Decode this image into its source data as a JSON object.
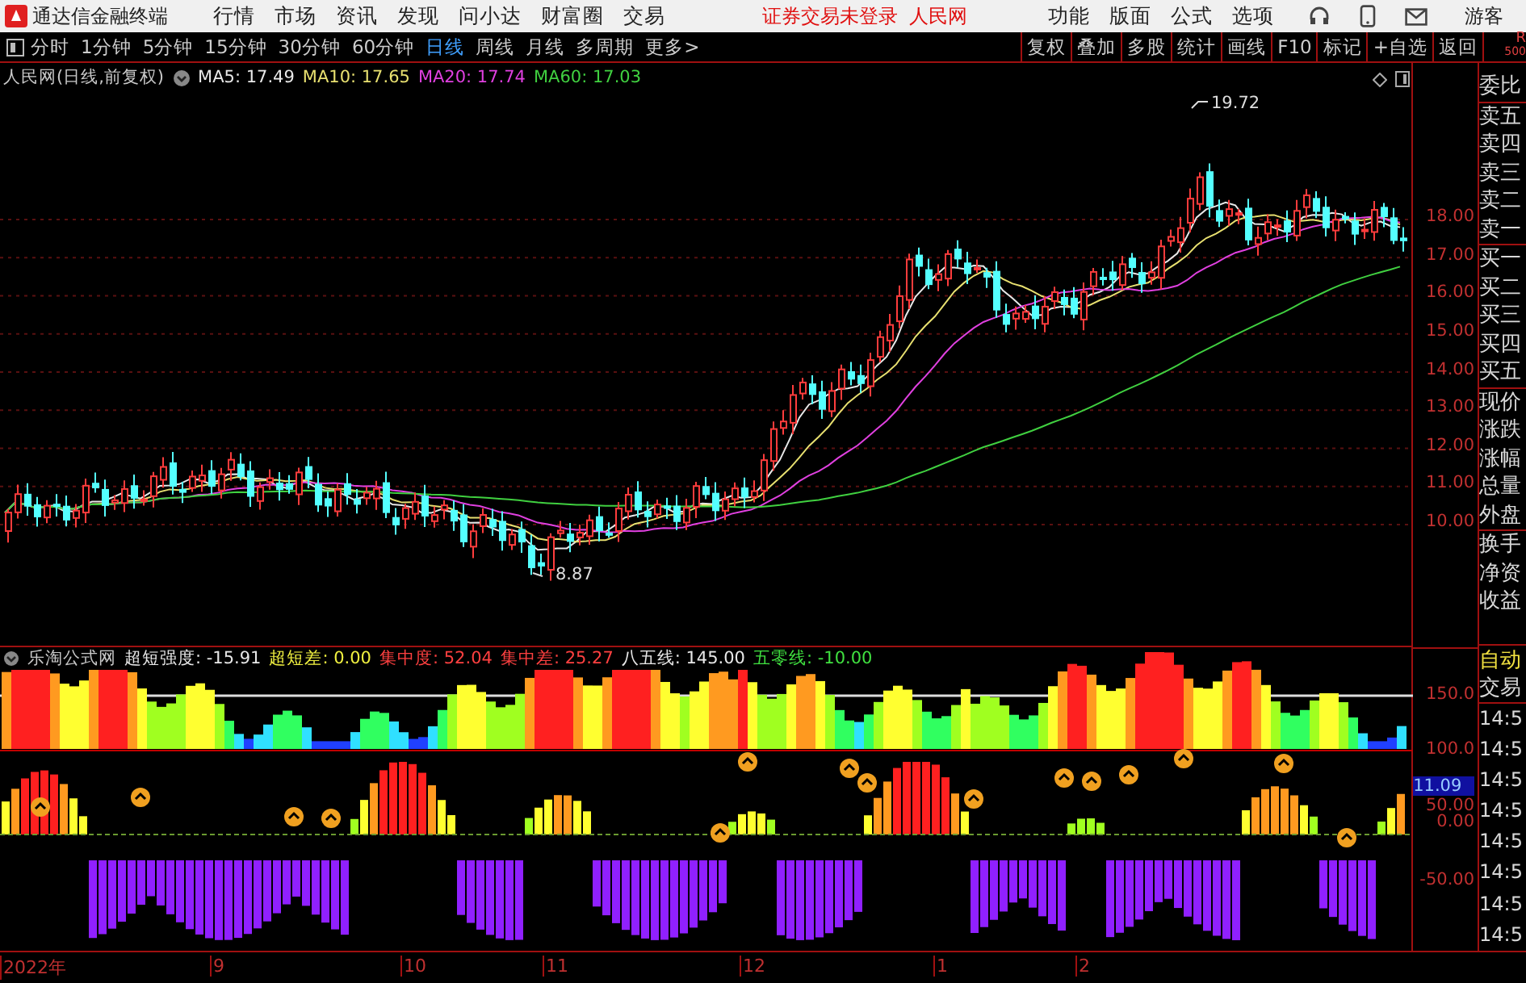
{
  "app": {
    "title": "通达信金融终端",
    "menu": [
      "行情",
      "市场",
      "资讯",
      "发现",
      "问小达",
      "财富圈",
      "交易"
    ],
    "notice": "证券交易未登录",
    "stock": "人民网",
    "tools": [
      "功能",
      "版面",
      "公式",
      "选项"
    ],
    "user": "游客",
    "corner": [
      "R",
      "500"
    ]
  },
  "periods": [
    {
      "label": "分时",
      "selected": false
    },
    {
      "label": "1分钟",
      "selected": false
    },
    {
      "label": "5分钟",
      "selected": false
    },
    {
      "label": "15分钟",
      "selected": false
    },
    {
      "label": "30分钟",
      "selected": false
    },
    {
      "label": "60分钟",
      "selected": false
    },
    {
      "label": "日线",
      "selected": true
    },
    {
      "label": "周线",
      "selected": false
    },
    {
      "label": "月线",
      "selected": false
    },
    {
      "label": "多周期",
      "selected": false
    },
    {
      "label": "更多>",
      "selected": false
    }
  ],
  "actions": [
    "复权",
    "叠加",
    "多股",
    "统计",
    "画线",
    "F10",
    "标记",
    "+自选",
    "返回"
  ],
  "price_panel": {
    "title": "人民网(日线,前复权)",
    "indicators": [
      {
        "label": "MA5: 17.49",
        "color": "#e8e8e8"
      },
      {
        "label": "MA10: 17.65",
        "color": "#e8e070"
      },
      {
        "label": "MA20: 17.74",
        "color": "#e040e0"
      },
      {
        "label": "MA60: 17.03",
        "color": "#40d040"
      }
    ],
    "axis": [
      "18.00",
      "17.00",
      "16.00",
      "15.00",
      "14.00",
      "13.00",
      "12.00",
      "11.00",
      "10.00"
    ],
    "high_label": "19.72",
    "low_label": "8.87"
  },
  "indicator_panel": {
    "title": "乐淘公式网",
    "values": [
      {
        "label": "超短强度: -15.91",
        "color": "#e8e8e8"
      },
      {
        "label": "超短差: 0.00",
        "color": "#f0f040"
      },
      {
        "label": "集中度: 52.04",
        "color": "#ff4040"
      },
      {
        "label": "集中差: 25.27",
        "color": "#ff4040"
      },
      {
        "label": "八五线: 145.00",
        "color": "#e8e8e8"
      },
      {
        "label": "五零线: -10.00",
        "color": "#40e040"
      }
    ],
    "axis": [
      "150.0",
      "100.0",
      "50.00",
      "0.00",
      "-50.00"
    ],
    "current": "11.09"
  },
  "side_panel": {
    "groups": [
      [
        "委比"
      ],
      [
        "卖五",
        "卖四",
        "卖三",
        "卖二",
        "卖一"
      ],
      [
        "买一",
        "买二",
        "买三",
        "买四",
        "买五"
      ],
      [
        "现价",
        "涨跌",
        "涨幅",
        "总量",
        "外盘"
      ],
      [
        "换手",
        "净资",
        "收益"
      ]
    ],
    "mode": "自动",
    "trade": "交易",
    "times": [
      "14:5",
      "14:5",
      "14:5",
      "14:5",
      "14:5",
      "14:5",
      "14:5",
      "14:5"
    ]
  },
  "dates": [
    "2022年",
    "9",
    "10",
    "11",
    "12",
    "1",
    "2"
  ]
}
